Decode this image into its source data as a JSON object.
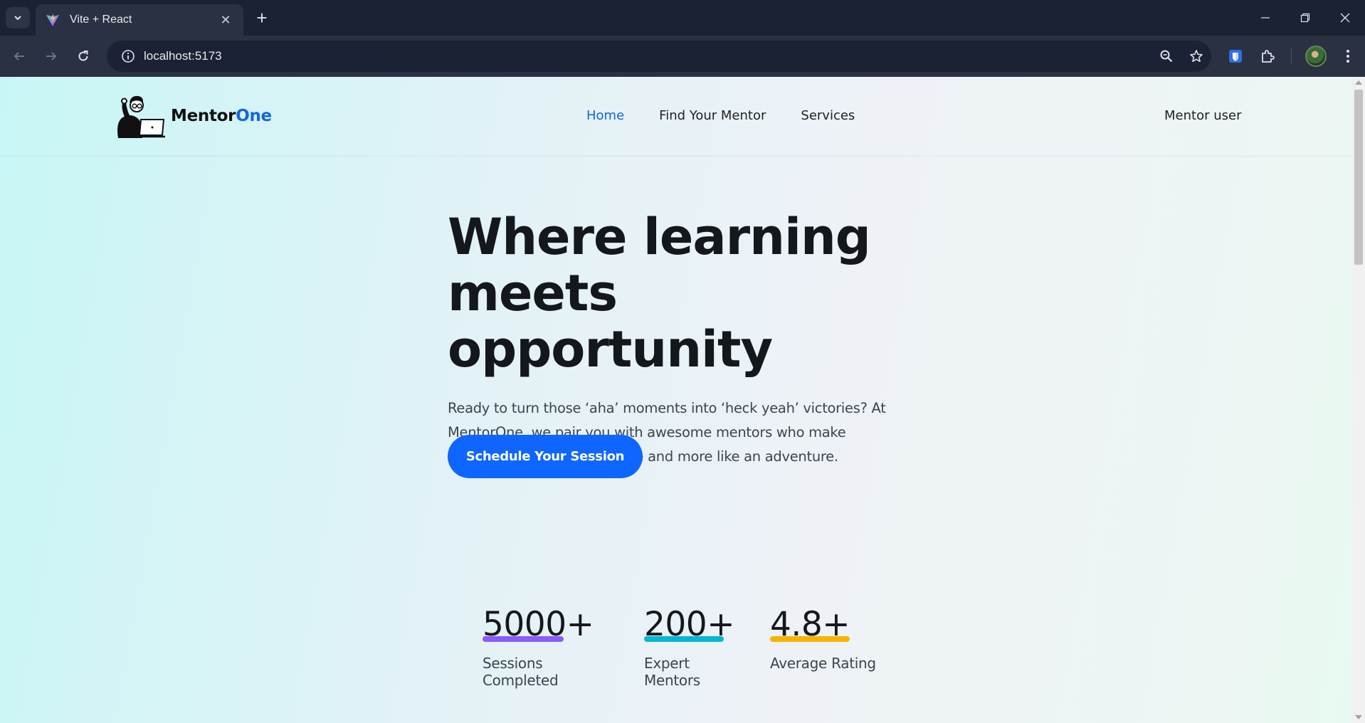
{
  "browser": {
    "tab_title": "Vite + React",
    "url": "localhost:5173"
  },
  "site": {
    "logo_primary": "Mentor",
    "logo_accent": "One",
    "nav": [
      {
        "label": "Home",
        "active": true
      },
      {
        "label": "Find Your Mentor",
        "active": false
      },
      {
        "label": "Services",
        "active": false
      }
    ],
    "user_label": "Mentor user"
  },
  "hero": {
    "title_line1": "Where learning",
    "title_line2": "meets opportunity",
    "description": "Ready to turn those ‘aha’ moments into ‘heck yeah’ victories? At MentorOne, we pair you with awesome mentors who make learning feel less like a chore and more like an adventure.",
    "cta_label": "Schedule Your Session"
  },
  "stats": [
    {
      "value": "5000+",
      "label": "Sessions Completed",
      "underline_color": "#8b5cf6"
    },
    {
      "value": "200+",
      "label": "Expert Mentors",
      "underline_color": "#06b6d4"
    },
    {
      "value": "4.8+",
      "label": "Average Rating",
      "underline_color": "#f5b400"
    }
  ],
  "colors": {
    "accent": "#1565e0",
    "cta": "#0f66ff"
  }
}
